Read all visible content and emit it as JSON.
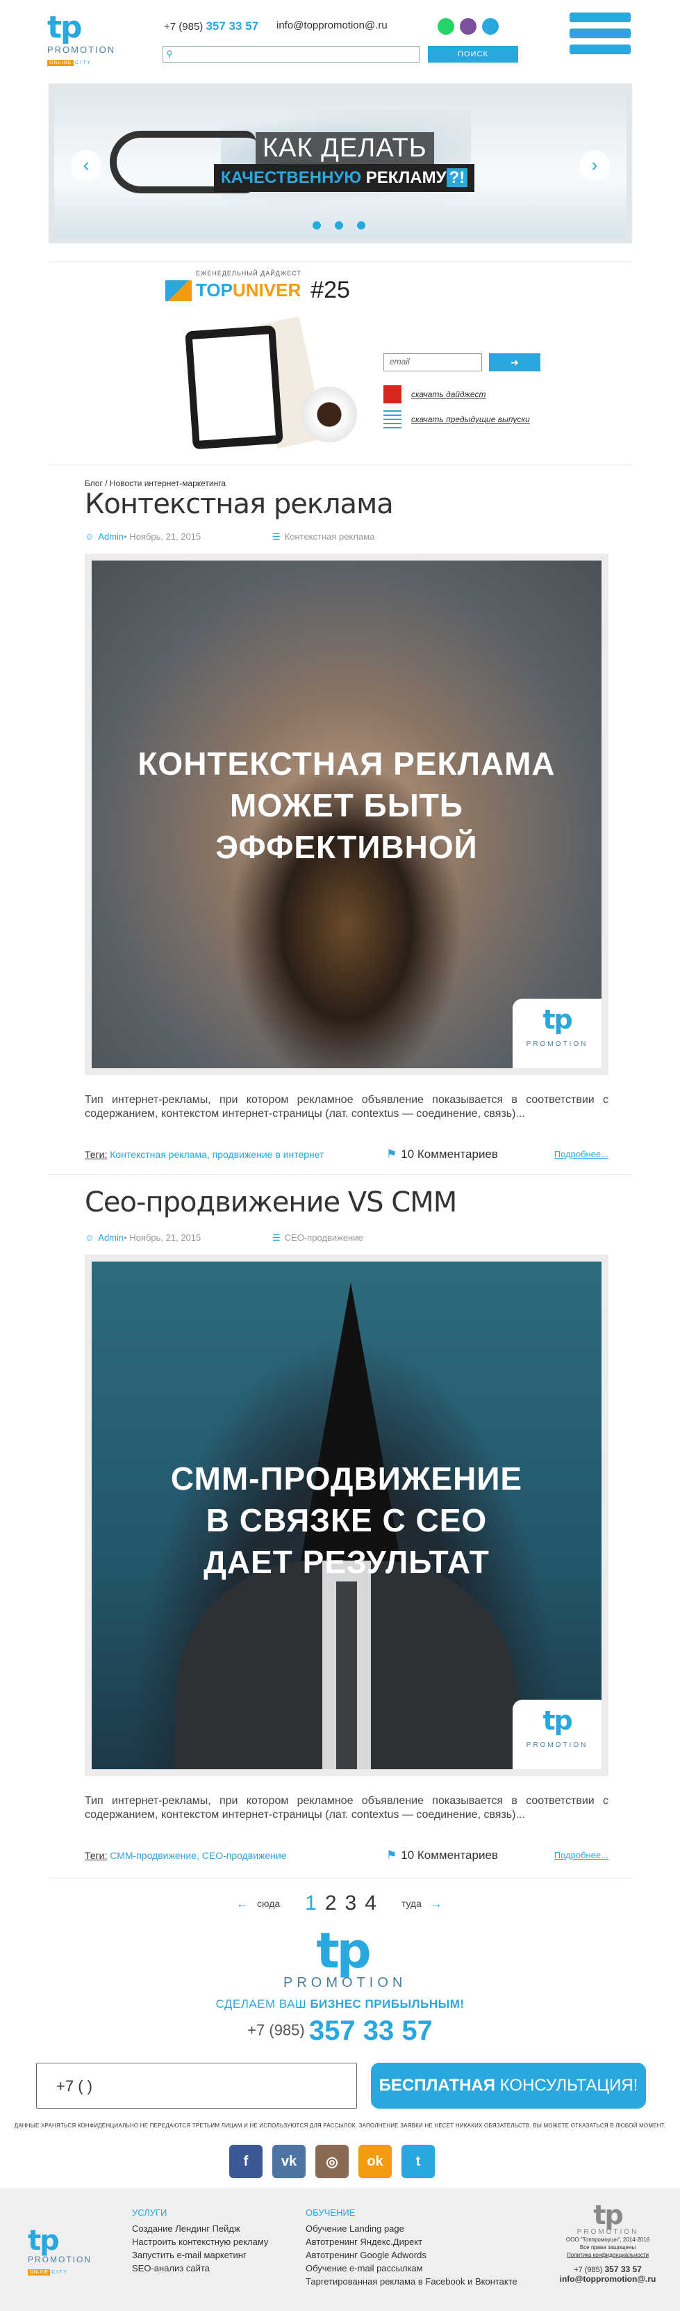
{
  "header": {
    "logo": {
      "mark": "tp",
      "word": "PROMOTION",
      "tag": "ONLINE",
      "tag2": "CITY"
    },
    "phone_prefix": "+7 (985)",
    "phone_main": "357 33 57",
    "email": "info@toppromotion@.ru",
    "social_icons": [
      "whatsapp-icon",
      "viber-icon",
      "telegram-icon"
    ],
    "search_placeholder": "",
    "search_button": "ПОИСК"
  },
  "slider": {
    "headline": "КАК ДЕЛАТЬ",
    "subline_accent": "КАЧЕСТВЕННУЮ",
    "subline_rest": "РЕКЛАМУ",
    "subline_end": "?!",
    "prev": "‹",
    "next": "›",
    "dots": 3
  },
  "digest": {
    "small": "ЕЖЕНЕДЕЛЬНЫЙ ДАЙДЖЕСТ",
    "top": "TOP",
    "univer": "UNIVER",
    "number": "#25",
    "email_placeholder": "email",
    "submit_icon": "login-icon",
    "download_label": "скачать дайджест",
    "previous_label": "скачать предыдущие выпуски"
  },
  "posts": [
    {
      "breadcrumb": "Блог / Новости интернет-маркетинга",
      "title": "Контекстная реклама",
      "author": "Admin",
      "date": " • Ноябрь, 21, 2015",
      "category": "Контекстная реклама",
      "image_caption": [
        "КОНТЕКСТНАЯ РЕКЛАМА",
        "МОЖЕТ БЫТЬ",
        "ЭФФЕКТИВНОЙ"
      ],
      "excerpt": "Тип интернет-рекламы, при котором рекламное объявление показывается в соответствии с содержанием, контекстом интернет-страницы (лат. contextus — соединение, связь)...",
      "tags_label": "Теги:",
      "tags": "Контекстная реклама, продвижение в интернет",
      "comments": "10 Комментариев",
      "more": "Подробнее..."
    },
    {
      "breadcrumb": "",
      "title": "Сео-продвижение VS СММ",
      "author": "Admin",
      "date": " • Ноябрь, 21, 2015",
      "category": "СЕО-продвижение",
      "image_caption": [
        "СММ-ПРОДВИЖЕНИЕ",
        "В СВЯЗКЕ С СЕО",
        "ДАЕТ РЕЗУЛЬТАТ"
      ],
      "excerpt": "Тип интернет-рекламы, при котором рекламное объявление показывается в соответствии с содержанием, контекстом интернет-страницы (лат. contextus — соединение, связь)...",
      "tags_label": "Теги:",
      "tags": "СММ-продвижение, СЕО-продвижение",
      "comments": "10 Комментариев",
      "more": "Подробнее..."
    }
  ],
  "badge": {
    "mark": "tp",
    "word": "PROMOTION"
  },
  "pagination": {
    "prev_label": "сюда",
    "next_label": "туда",
    "pages": [
      "1",
      "2",
      "3",
      "4"
    ],
    "active": "1"
  },
  "promo": {
    "logo_mark": "tp",
    "logo_word": "PROMOTION",
    "slogan_start": "СДЕЛАЕМ ВАШ ",
    "slogan_bold": "БИЗНЕС ПРИБЫЛЬНЫМ!",
    "phone_prefix": "+7 (985)",
    "phone_main": "357 33 57",
    "phone_input_value": "+7 (        )",
    "consult_bold": "БЕСПЛАТНАЯ",
    "consult_rest": " КОНСУЛЬТАЦИЯ!",
    "disclaimer": "ДАННЫЕ ХРАНЯТЬСЯ КОНФИДЕНЦИАЛЬНО НЕ ПЕРЕДАЮТСЯ ТРЕТЬИМ ЛИЦАМ И НЕ ИСПОЛЬЗУЮТСЯ ДЛЯ РАССЫЛОК. ЗАПОЛНЕНИЕ ЗАЯВКИ НЕ НЕСЕТ НИКАКИХ ОБЯЗАТЕЛЬСТВ. ВЫ МОЖЕТЕ ОТКАЗАТЬСЯ В ЛЮБОЙ МОМЕНТ.",
    "socials": [
      {
        "icon": "facebook-icon",
        "glyph": "f",
        "color": "#3b5998"
      },
      {
        "icon": "vk-icon",
        "glyph": "vk",
        "color": "#4c75a3"
      },
      {
        "icon": "instagram-icon",
        "glyph": "◎",
        "color": "#8a6a52"
      },
      {
        "icon": "odnoklassniki-icon",
        "glyph": "ok",
        "color": "#f39c12"
      },
      {
        "icon": "twitter-icon",
        "glyph": "t",
        "color": "#29a8df"
      }
    ]
  },
  "footer": {
    "logo": {
      "mark": "tp",
      "word": "PROMOTION",
      "tag": "ONLINE",
      "tag2": "CITY"
    },
    "services_head": "УСЛУГИ",
    "services": [
      "Создание Лендинг Пейдж",
      "Настроить контекстную рекламу",
      "Запустить e-mail маркетинг",
      "SEO-анализ сайта"
    ],
    "education_head": "ОБУЧЕНИЕ",
    "education": [
      "Обучение Landing page",
      "Автотренинг Яндекс.Директ",
      "Автотренинг Google Adwords",
      "Обучение e-mail рассылкам",
      "Таргетированная реклама в Facebook и Вконтакте"
    ],
    "right_mark": "tp",
    "right_word": "PROMOTION",
    "copyright": "ООО \"Топпромоушн\", 2014-2016",
    "rights": "Все права защищены",
    "policy": "Политика конфиденциальности",
    "phone_prefix": "+7 (985) ",
    "phone_main": "357 33 57",
    "email": "info@toppromotion@.ru"
  }
}
